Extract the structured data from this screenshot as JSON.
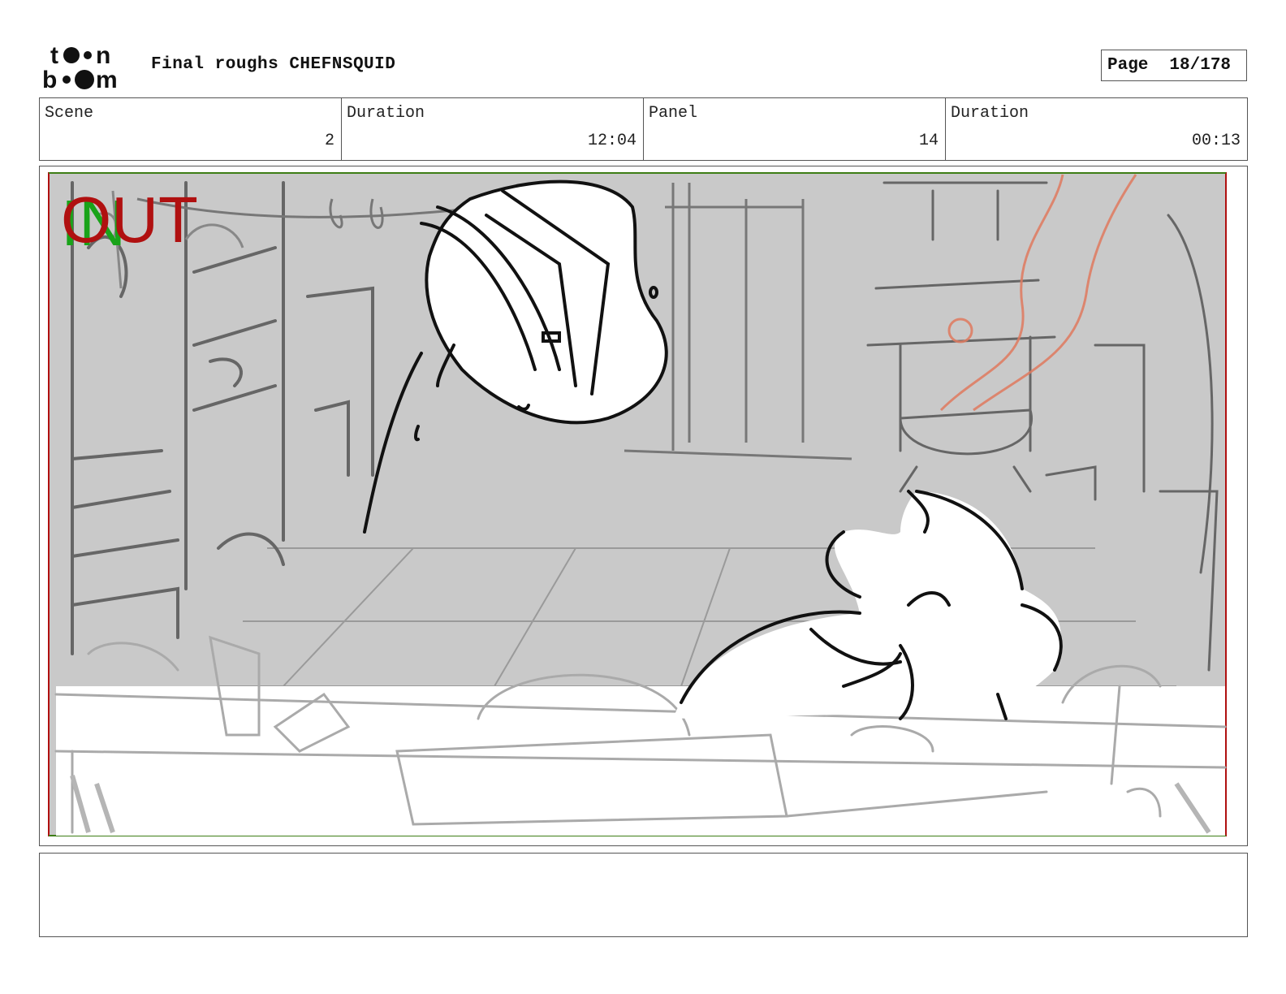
{
  "header": {
    "logo_alt": "toon boom",
    "title": "Final roughs CHEFNSQUID",
    "page_label": "Page",
    "page_value": "18/178"
  },
  "info": [
    {
      "label": "Scene",
      "value": "2"
    },
    {
      "label": "Duration",
      "value": "12:04"
    },
    {
      "label": "Panel",
      "value": "14"
    },
    {
      "label": "Duration",
      "value": "00:13"
    }
  ],
  "panel": {
    "in_marker": "IN",
    "out_marker": "OUT",
    "colors": {
      "in": "#19a319",
      "out": "#b01010",
      "background": "#c8c8c8",
      "sketch": "#555555",
      "steam": "#e07a5f"
    }
  },
  "notes": {
    "text": ""
  }
}
